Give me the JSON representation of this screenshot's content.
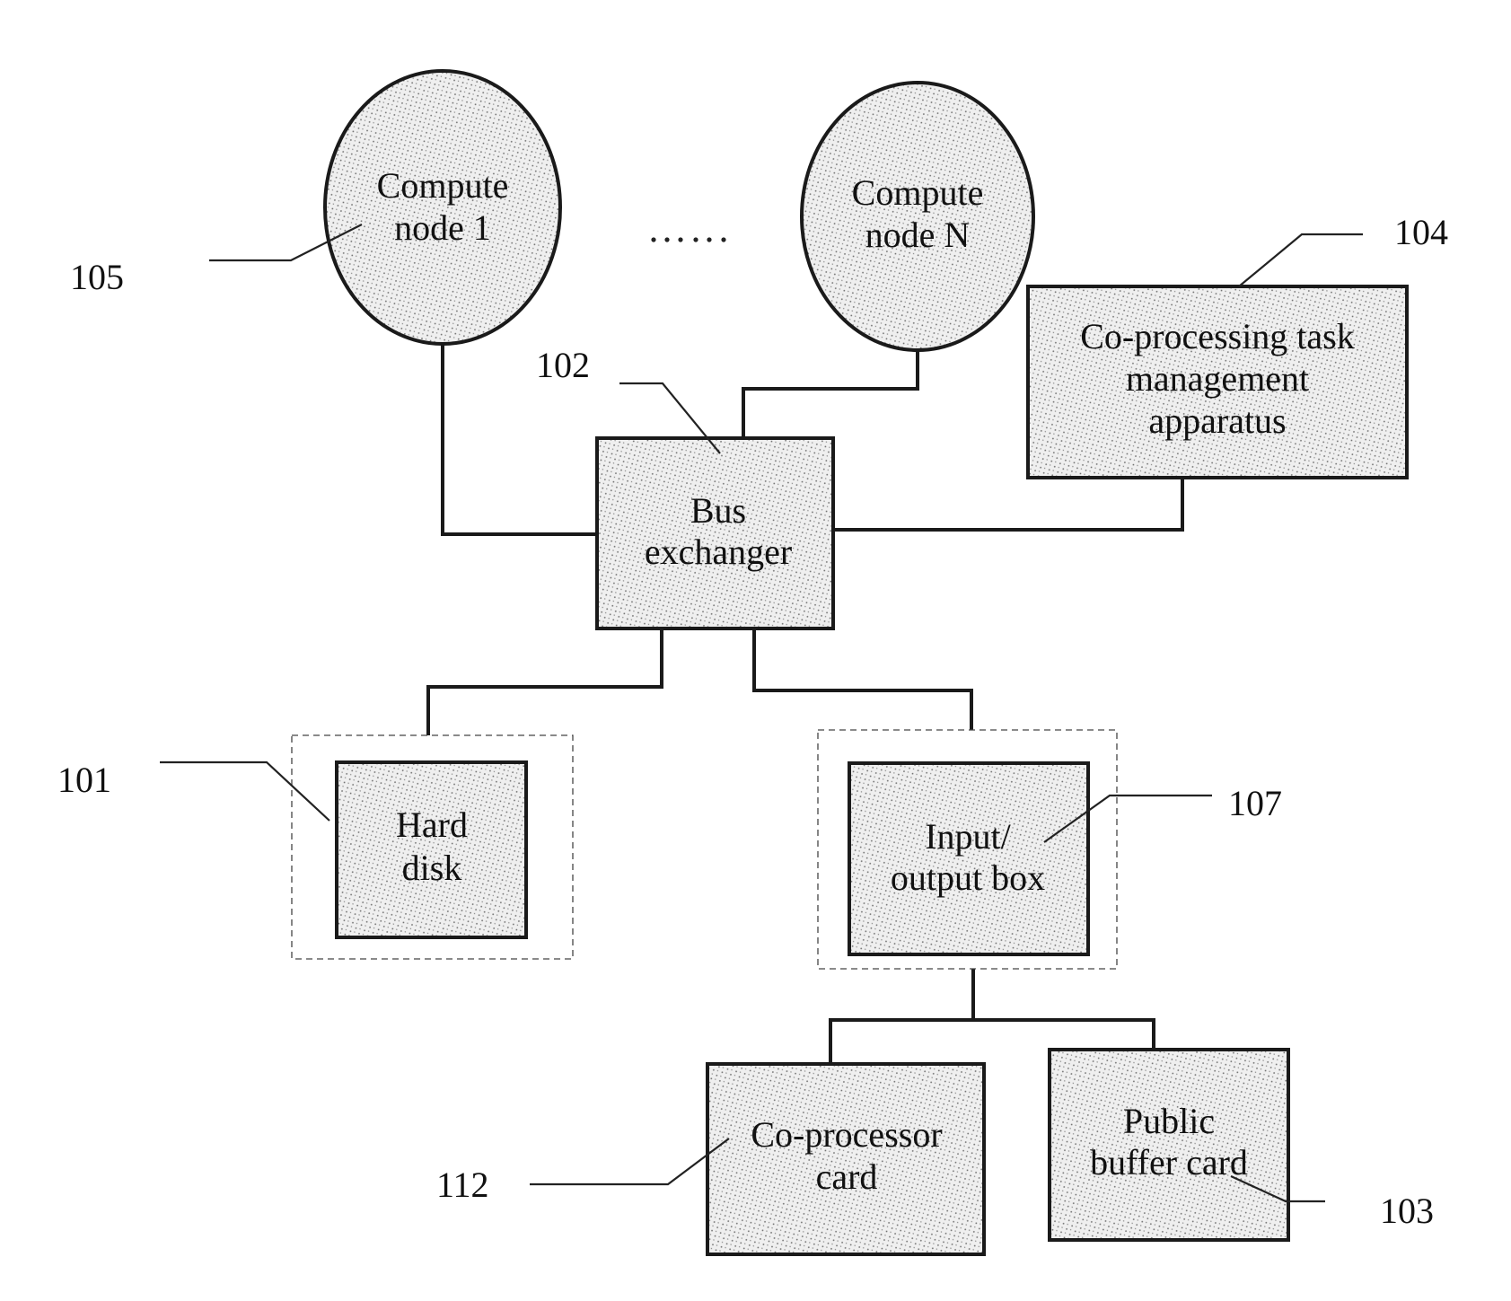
{
  "diagram": {
    "type": "block-diagram",
    "fill_color": "#e4e4e4",
    "line_color": "#1a1a1a",
    "nodes": {
      "compute_node_1": {
        "lines": [
          "Compute",
          "node 1"
        ],
        "ref": "105",
        "shape": "ellipse"
      },
      "compute_node_n": {
        "lines": [
          "Compute",
          "node N"
        ],
        "shape": "ellipse"
      },
      "ellipsis": {
        "text": "......",
        "meaning": "additional compute nodes omitted"
      },
      "bus_exchanger": {
        "lines": [
          "Bus",
          "exchanger"
        ],
        "ref": "102",
        "shape": "rect"
      },
      "task_manager": {
        "lines": [
          "Co-processing task",
          "management",
          "apparatus"
        ],
        "ref": "104",
        "shape": "rect"
      },
      "hard_disk": {
        "lines": [
          "Hard",
          "disk"
        ],
        "ref": "101",
        "shape": "rect",
        "grouped": "dashed"
      },
      "io_box": {
        "lines": [
          "Input/",
          "output box"
        ],
        "ref": "107",
        "shape": "rect",
        "grouped": "dashed"
      },
      "coprocessor_card": {
        "lines": [
          "Co-processor",
          "card"
        ],
        "ref": "112",
        "shape": "rect"
      },
      "public_buffer_card": {
        "lines": [
          "Public",
          "buffer card"
        ],
        "ref": "103",
        "shape": "rect"
      }
    },
    "refs": {
      "r105": "105",
      "r102": "102",
      "r104": "104",
      "r101": "101",
      "r107": "107",
      "r112": "112",
      "r103": "103"
    },
    "connections": [
      {
        "from": "compute_node_1",
        "to": "bus_exchanger"
      },
      {
        "from": "compute_node_n",
        "to": "bus_exchanger"
      },
      {
        "from": "task_manager",
        "to": "bus_exchanger"
      },
      {
        "from": "bus_exchanger",
        "to": "hard_disk"
      },
      {
        "from": "bus_exchanger",
        "to": "io_box"
      },
      {
        "from": "io_box",
        "to": "coprocessor_card"
      },
      {
        "from": "io_box",
        "to": "public_buffer_card"
      }
    ]
  }
}
